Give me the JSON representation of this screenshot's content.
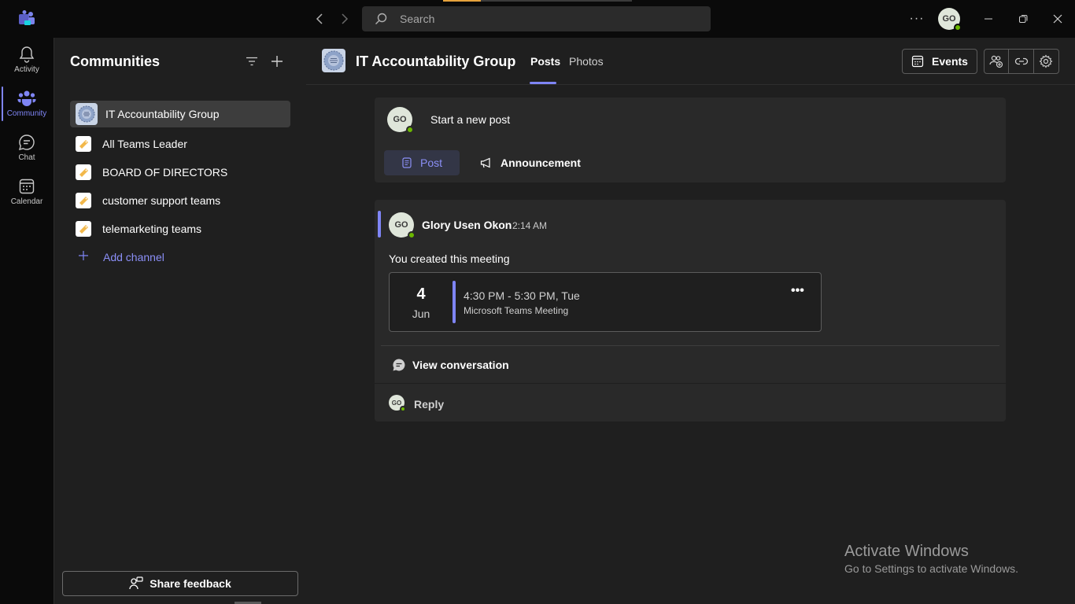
{
  "titlebar": {
    "search_placeholder": "Search",
    "more_label": "···",
    "user_initials": "GO",
    "accent_color": "#e6a23c"
  },
  "rail": {
    "items": [
      {
        "label": "Activity",
        "icon": "bell-icon"
      },
      {
        "label": "Community",
        "icon": "community-icon"
      },
      {
        "label": "Chat",
        "icon": "chat-icon"
      },
      {
        "label": "Calendar",
        "icon": "calendar-icon"
      }
    ]
  },
  "sidebar": {
    "title": "Communities",
    "channels": [
      {
        "label": "IT Accountability Group",
        "selected": true
      },
      {
        "label": "All Teams Leader"
      },
      {
        "label": "BOARD OF DIRECTORS"
      },
      {
        "label": "customer support teams"
      },
      {
        "label": "telemarketing teams"
      }
    ],
    "add_channel": "Add channel",
    "feedback": "Share feedback"
  },
  "header": {
    "title": "IT Accountability Group",
    "tabs": [
      {
        "label": "Posts",
        "active": true
      },
      {
        "label": "Photos"
      }
    ],
    "events": "Events"
  },
  "composer": {
    "avatar": "GO",
    "start": "Start a new post",
    "post": "Post",
    "announcement": "Announcement"
  },
  "thread": {
    "avatar": "GO",
    "author": "Glory Usen Okon",
    "time": "2:14 AM",
    "message": "You created this meeting",
    "meeting": {
      "day": "4",
      "month": "Jun",
      "time": "4:30 PM - 5:30 PM, Tue",
      "type": "Microsoft Teams Meeting",
      "more": "•••"
    },
    "view_conversation": "View conversation",
    "reply_avatar": "GO",
    "reply": "Reply"
  },
  "watermark": {
    "line1": "Activate Windows",
    "line2": "Go to Settings to activate Windows."
  },
  "colors": {
    "accent": "#7f85f5",
    "presence": "#6bb700",
    "background": "#1f1f1f",
    "card": "#292929"
  }
}
